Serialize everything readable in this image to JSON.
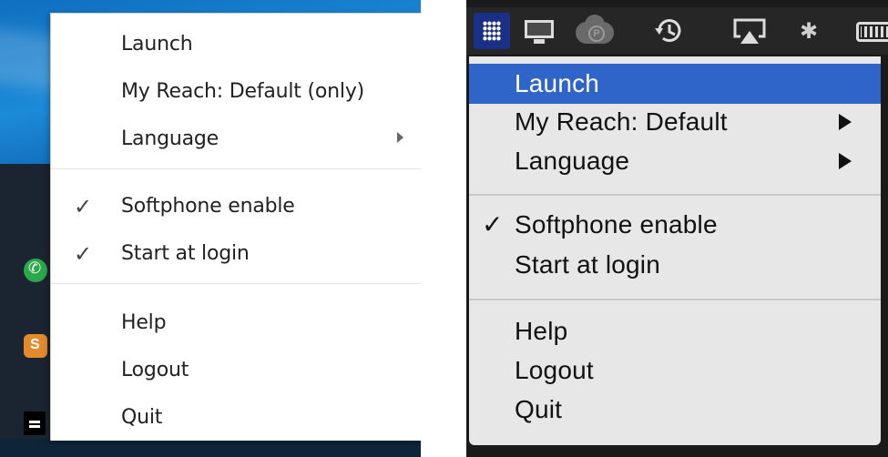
{
  "windows_menu": {
    "items": [
      {
        "label": "Launch",
        "checked": false,
        "submenu": false
      },
      {
        "label": "My Reach: Default (only)",
        "checked": false,
        "submenu": false
      },
      {
        "label": "Language",
        "checked": false,
        "submenu": true
      },
      {
        "label": "Softphone enable",
        "checked": true,
        "submenu": false
      },
      {
        "label": "Start at login",
        "checked": true,
        "submenu": false
      },
      {
        "label": "Help",
        "checked": false,
        "submenu": false
      },
      {
        "label": "Logout",
        "checked": false,
        "submenu": false
      },
      {
        "label": "Quit",
        "checked": false,
        "submenu": false
      }
    ],
    "check_glyph": "✓",
    "tray_icons": [
      "phone-icon",
      "orange-app-icon",
      "taskbar-icon"
    ]
  },
  "mac_menu": {
    "menubar_icons": [
      "app-grid-icon",
      "display-icon",
      "cloud-p-icon",
      "time-machine-icon",
      "airplay-icon",
      "bluetooth-icon",
      "battery-icon"
    ],
    "bluetooth_glyph": "✱",
    "items": [
      {
        "label": "Launch",
        "checked": false,
        "submenu": false,
        "highlighted": true
      },
      {
        "label": "My Reach: Default",
        "checked": false,
        "submenu": true,
        "highlighted": false
      },
      {
        "label": "Language",
        "checked": false,
        "submenu": true,
        "highlighted": false
      },
      {
        "label": "Softphone enable",
        "checked": true,
        "submenu": false,
        "highlighted": false
      },
      {
        "label": "Start at login",
        "checked": false,
        "submenu": false,
        "highlighted": false
      },
      {
        "label": "Help",
        "checked": false,
        "submenu": false,
        "highlighted": false
      },
      {
        "label": "Logout",
        "checked": false,
        "submenu": false,
        "highlighted": false
      },
      {
        "label": "Quit",
        "checked": false,
        "submenu": false,
        "highlighted": false
      }
    ],
    "check_glyph": "✓"
  },
  "colors": {
    "mac_highlight": "#2f64c9",
    "mac_menu_bg": "#e7e7e7",
    "win_menu_bg": "#ffffff",
    "win_desktop": "#0b5fb0"
  }
}
